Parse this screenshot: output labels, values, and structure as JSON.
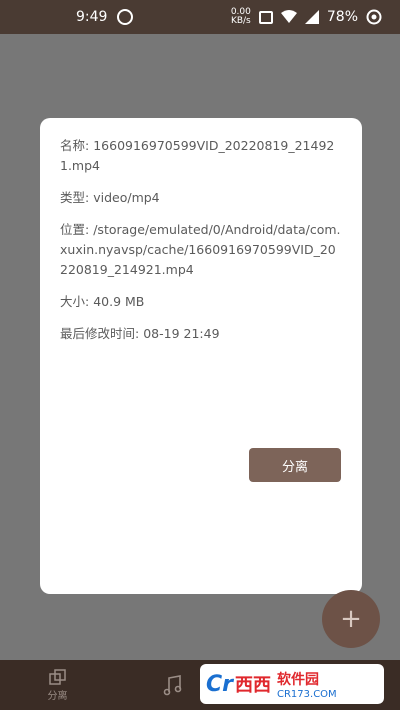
{
  "status_bar": {
    "time": "9:49",
    "net_speed_top": "0.00",
    "net_speed_bottom": "KB/s",
    "battery": "78%"
  },
  "dialog": {
    "name_label": "名称:",
    "name_value": "1660916970599VID_20220819_214921.mp4",
    "type_label": "类型:",
    "type_value": "video/mp4",
    "location_label": "位置:",
    "location_value": "/storage/emulated/0/Android/data/com.xuxin.nyavsp/cache/1660916970599VID_20220819_214921.mp4",
    "size_label": "大小:",
    "size_value": "40.9 MB",
    "modified_label": "最后修改时间:",
    "modified_value": "08-19 21:49",
    "split_button": "分离"
  },
  "fab": {
    "label": "+"
  },
  "bottom_nav": {
    "items": [
      {
        "label": "分离",
        "icon": "split-icon"
      },
      {
        "label": "",
        "icon": "music-icon"
      }
    ]
  },
  "watermark": {
    "logo": "Cr",
    "brand": "西西",
    "name": "软件园",
    "domain": "CR173.COM"
  }
}
